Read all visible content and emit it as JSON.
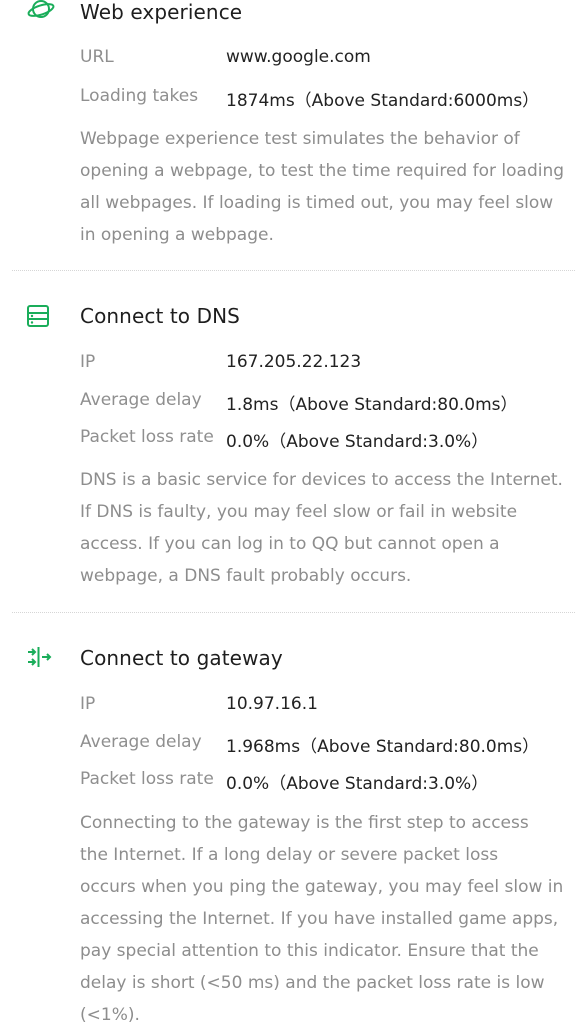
{
  "colors": {
    "accent": "#1aad5a",
    "label": "#8f8f8f",
    "value": "#222222",
    "description": "#8d8d8d",
    "divider": "#d6d6d6"
  },
  "web": {
    "icon": "planet-icon",
    "title": "Web experience",
    "rows": [
      {
        "label": "URL",
        "value": "www.google.com"
      },
      {
        "label": "Loading takes",
        "value": "1874ms（Above Standard:6000ms）"
      }
    ],
    "description_lines": [
      "Webpage experience test simulates the behavior of",
      "opening a webpage, to test the time required for loading",
      "all webpages. If loading is timed out, you may feel slow",
      "in opening a webpage."
    ]
  },
  "dns": {
    "icon": "server-icon",
    "title": "Connect to DNS",
    "rows": [
      {
        "label": "IP",
        "value": "167.205.22.123"
      },
      {
        "label": "Average delay",
        "value": "1.8ms（Above Standard:80.0ms）"
      },
      {
        "label": "Packet loss rate",
        "value": "0.0%（Above Standard:3.0%）"
      }
    ],
    "description_lines": [
      "DNS is a basic service for devices to access the Internet.",
      "If DNS is faulty, you may feel slow or fail in website",
      "access. If you can log in to QQ but cannot open a",
      "webpage, a DNS fault probably occurs."
    ]
  },
  "gateway": {
    "icon": "gateway-arrows-icon",
    "title": "Connect to gateway",
    "rows": [
      {
        "label": "IP",
        "value": "10.97.16.1"
      },
      {
        "label": "Average delay",
        "value": "1.968ms（Above Standard:80.0ms）"
      },
      {
        "label": "Packet loss rate",
        "value": "0.0%（Above Standard:3.0%）"
      }
    ],
    "description_lines": [
      "Connecting to the gateway is the first step to access",
      "the Internet. If a long delay or severe packet loss",
      "occurs when you ping the gateway, you may feel slow in",
      "accessing the Internet. If you have installed game apps,",
      "pay special attention to this indicator. Ensure that the",
      "delay is short (<50 ms) and the packet loss rate is low",
      "(<1%)."
    ]
  }
}
